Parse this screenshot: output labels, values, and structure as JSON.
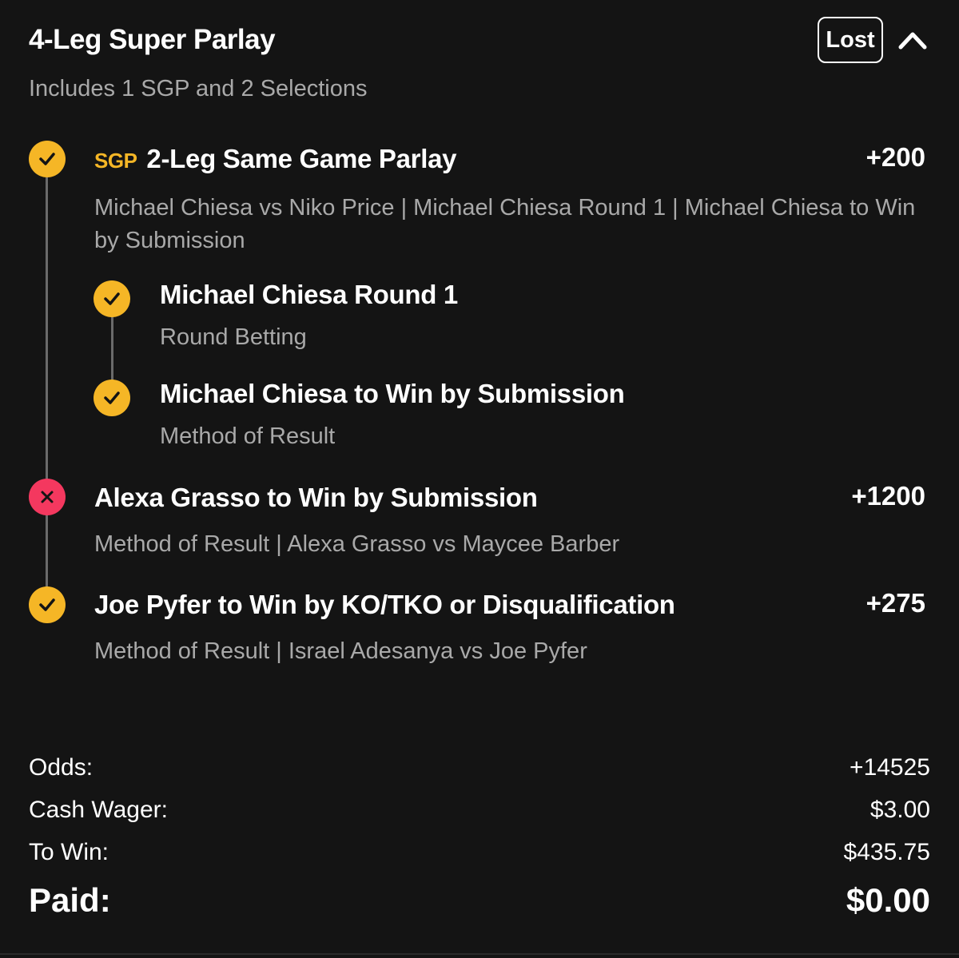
{
  "header": {
    "title": "4-Leg Super Parlay",
    "subtitle": "Includes 1 SGP and 2 Selections",
    "status": "Lost"
  },
  "colors": {
    "background": "#141414",
    "win": "#f5b626",
    "loss": "#f4385f",
    "muted_text": "#a9a9a9",
    "sgp_tag": "#f5b626"
  },
  "legs": [
    {
      "tag": "SGP",
      "title": "2-Leg Same Game Parlay",
      "odds": "+200",
      "description": "Michael Chiesa vs Niko Price | Michael Chiesa Round 1 | Michael Chiesa to Win by Submission",
      "result_icon": "check-icon",
      "sub_legs": [
        {
          "title": "Michael Chiesa Round 1",
          "meta": "Round Betting",
          "result_icon": "check-icon"
        },
        {
          "title": "Michael Chiesa to Win by Submission",
          "meta": "Method of Result",
          "result_icon": "check-icon"
        }
      ]
    },
    {
      "title": "Alexa Grasso to Win by Submission",
      "odds": "+1200",
      "meta": "Method of Result | Alexa Grasso vs Maycee Barber",
      "result_icon": "x-icon"
    },
    {
      "title": "Joe Pyfer to Win by KO/TKO or Disqualification",
      "odds": "+275",
      "meta": "Method of Result | Israel Adesanya vs Joe Pyfer",
      "result_icon": "check-icon"
    }
  ],
  "summary": {
    "odds_label": "Odds:",
    "odds_value": "+14525",
    "wager_label": "Cash Wager:",
    "wager_value": "$3.00",
    "to_win_label": "To Win:",
    "to_win_value": "$435.75",
    "paid_label": "Paid:",
    "paid_value": "$0.00"
  }
}
